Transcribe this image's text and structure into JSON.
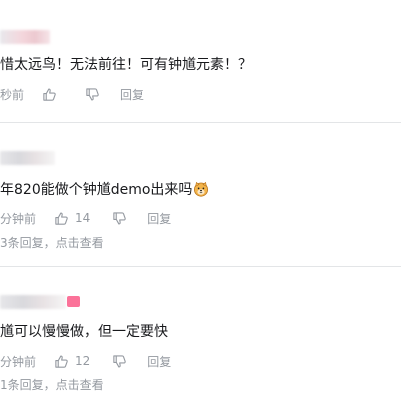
{
  "comments": [
    {
      "content": "惜太远鸟！无法前往！可有钟馗元素！？",
      "time": "秒前",
      "like_count": "",
      "reply_label": "回复",
      "sub_reply_text": ""
    },
    {
      "content": "年820能做个钟馗demo出来吗",
      "emoji": "doge-emoji",
      "time": "分钟前",
      "like_count": "14",
      "reply_label": "回复",
      "sub_reply_text": "3条回复，点击查看"
    },
    {
      "content": "馗可以慢慢做，但一定要快",
      "time": "分钟前",
      "like_count": "12",
      "reply_label": "回复",
      "sub_reply_text": "1条回复，点击查看"
    }
  ],
  "colors": {
    "text": "#18191c",
    "meta": "#9499a0",
    "divider": "#e3e5e7",
    "badge": "#fb7299"
  }
}
